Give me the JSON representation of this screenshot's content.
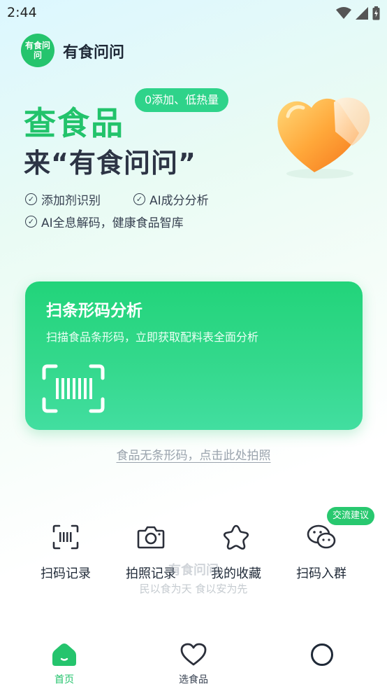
{
  "status_bar": {
    "time": "2:44"
  },
  "header": {
    "logo_text": "有食问问",
    "app_name": "有食问问"
  },
  "hero": {
    "title_line1": "查食品",
    "title_line2": "来“有食问问”",
    "badge": "0添加、低热量",
    "features": [
      "添加剂识别",
      "AI成分分析",
      "AI全息解码，健康食品智库"
    ]
  },
  "scan_card": {
    "title": "扫条形码分析",
    "subtitle": "扫描食品条形码，立即获取配料表全面分析"
  },
  "no_barcode_link": "食品无条形码，点击此处拍照",
  "quick_actions": [
    {
      "label": "扫码记录",
      "icon": "barcode-record-icon"
    },
    {
      "label": "拍照记录",
      "icon": "camera-icon"
    },
    {
      "label": "我的收藏",
      "icon": "star-icon"
    },
    {
      "label": "扫码入群",
      "icon": "wechat-icon"
    }
  ],
  "group_bubble": "交流建议",
  "watermark": {
    "name": "有食问问",
    "slogan": "民以食为天 食以安为先"
  },
  "bottom_nav": [
    {
      "label": "首页",
      "icon": "home-icon",
      "active": true
    },
    {
      "label": "选食品",
      "icon": "heart-icon",
      "active": false
    },
    {
      "label": "",
      "icon": "profile-circle-icon",
      "active": false
    }
  ],
  "colors": {
    "brand_green": "#22c36b",
    "card_green": "#2ed483"
  }
}
